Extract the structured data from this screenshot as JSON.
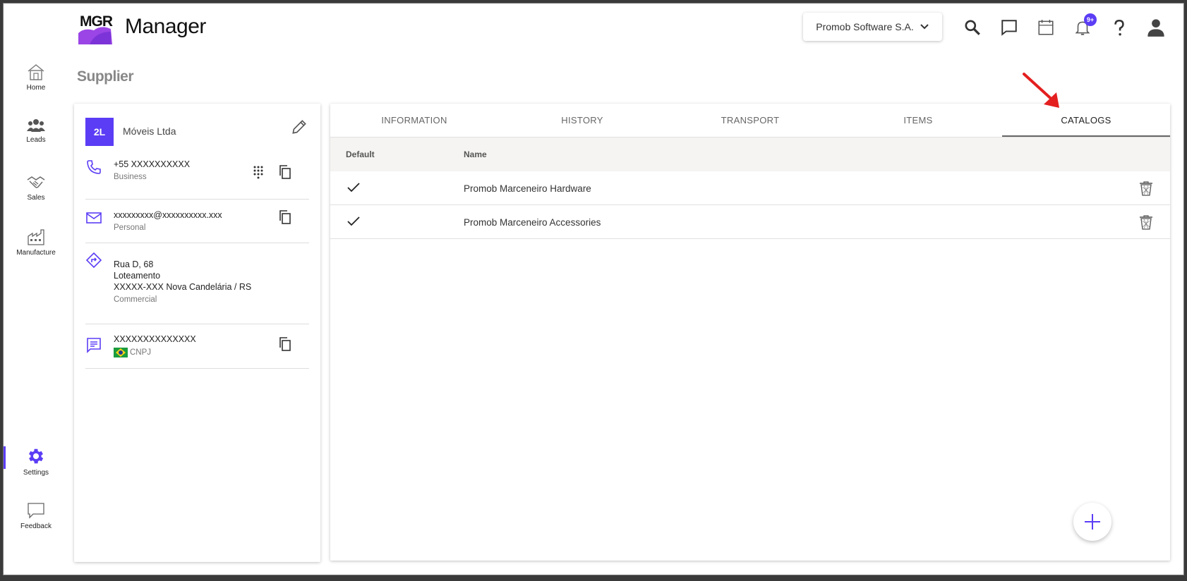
{
  "app": {
    "logo_text": "MGR",
    "title": "Manager"
  },
  "header": {
    "company": "Promob Software S.A.",
    "notifications_badge": "9+",
    "icons": [
      "search-icon",
      "chat-icon",
      "calendar-icon",
      "bell-icon",
      "help-icon",
      "account-icon"
    ]
  },
  "sidebar": {
    "items": [
      {
        "label": "Home",
        "icon": "home-icon"
      },
      {
        "label": "Leads",
        "icon": "people-icon"
      },
      {
        "label": "Sales",
        "icon": "handshake-icon"
      },
      {
        "label": "Manufacture",
        "icon": "factory-icon"
      },
      {
        "label": "Settings",
        "icon": "gear-icon",
        "active": true
      },
      {
        "label": "Feedback",
        "icon": "feedback-icon"
      }
    ]
  },
  "page": {
    "title": "Supplier"
  },
  "supplier": {
    "initials": "2L",
    "name": "Móveis Ltda",
    "phone": {
      "value": "+55 XXXXXXXXXX",
      "type": "Business"
    },
    "email": {
      "value": "xxxxxxxxx@xxxxxxxxxx.xxx",
      "type": "Personal"
    },
    "address": {
      "line1": "Rua D, 68",
      "line2": "Loteamento",
      "line3": "XXXXX-XXX Nova Candelária / RS",
      "type": "Commercial"
    },
    "document": {
      "value": "XXXXXXXXXXXXXX",
      "type": "CNPJ"
    }
  },
  "tabs": [
    {
      "label": "INFORMATION"
    },
    {
      "label": "HISTORY"
    },
    {
      "label": "TRANSPORT"
    },
    {
      "label": "ITEMS"
    },
    {
      "label": "CATALOGS",
      "active": true
    }
  ],
  "catalogs": {
    "headers": {
      "default": "Default",
      "name": "Name"
    },
    "rows": [
      {
        "default": true,
        "name": "Promob  Marceneiro Hardware"
      },
      {
        "default": true,
        "name": "Promob  Marceneiro Accessories"
      }
    ]
  },
  "colors": {
    "accent": "#5b3df5",
    "annotation_arrow": "#e41f1f"
  }
}
